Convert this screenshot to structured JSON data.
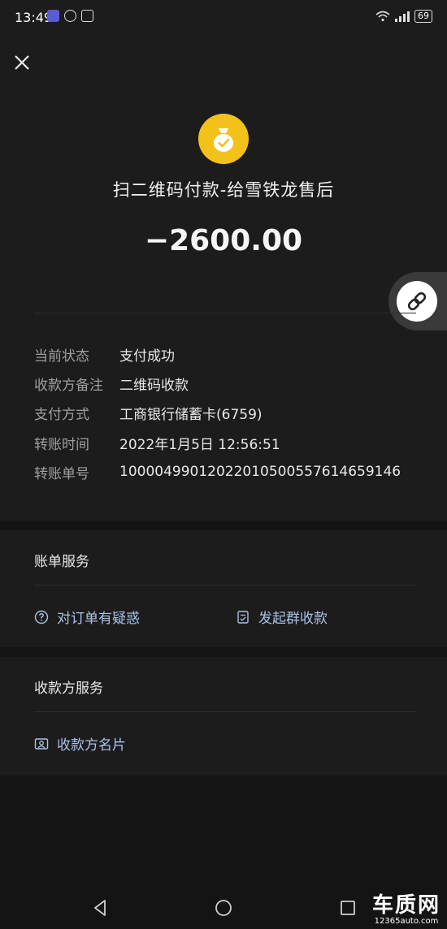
{
  "status_bar": {
    "time": "13:49",
    "battery": "69"
  },
  "header": {
    "merchant": "扫二维码付款-给雪铁龙售后",
    "amount": "−2600.00"
  },
  "details": [
    {
      "key": "当前状态",
      "value": "支付成功"
    },
    {
      "key": "收款方备注",
      "value": "二维码收款"
    },
    {
      "key": "支付方式",
      "value": "工商银行储蓄卡(6759)"
    },
    {
      "key": "转账时间",
      "value": "2022年1月5日 12:56:51"
    },
    {
      "key": "转账单号",
      "value": "10000499012022010500557614659146"
    }
  ],
  "bill_service": {
    "title": "账单服务",
    "question_label": "对订单有疑惑",
    "group_collect_label": "发起群收款"
  },
  "payee_service": {
    "title": "收款方服务",
    "card_label": "收款方名片"
  },
  "watermark": {
    "logo": "车质网",
    "url": "12365auto.com"
  }
}
